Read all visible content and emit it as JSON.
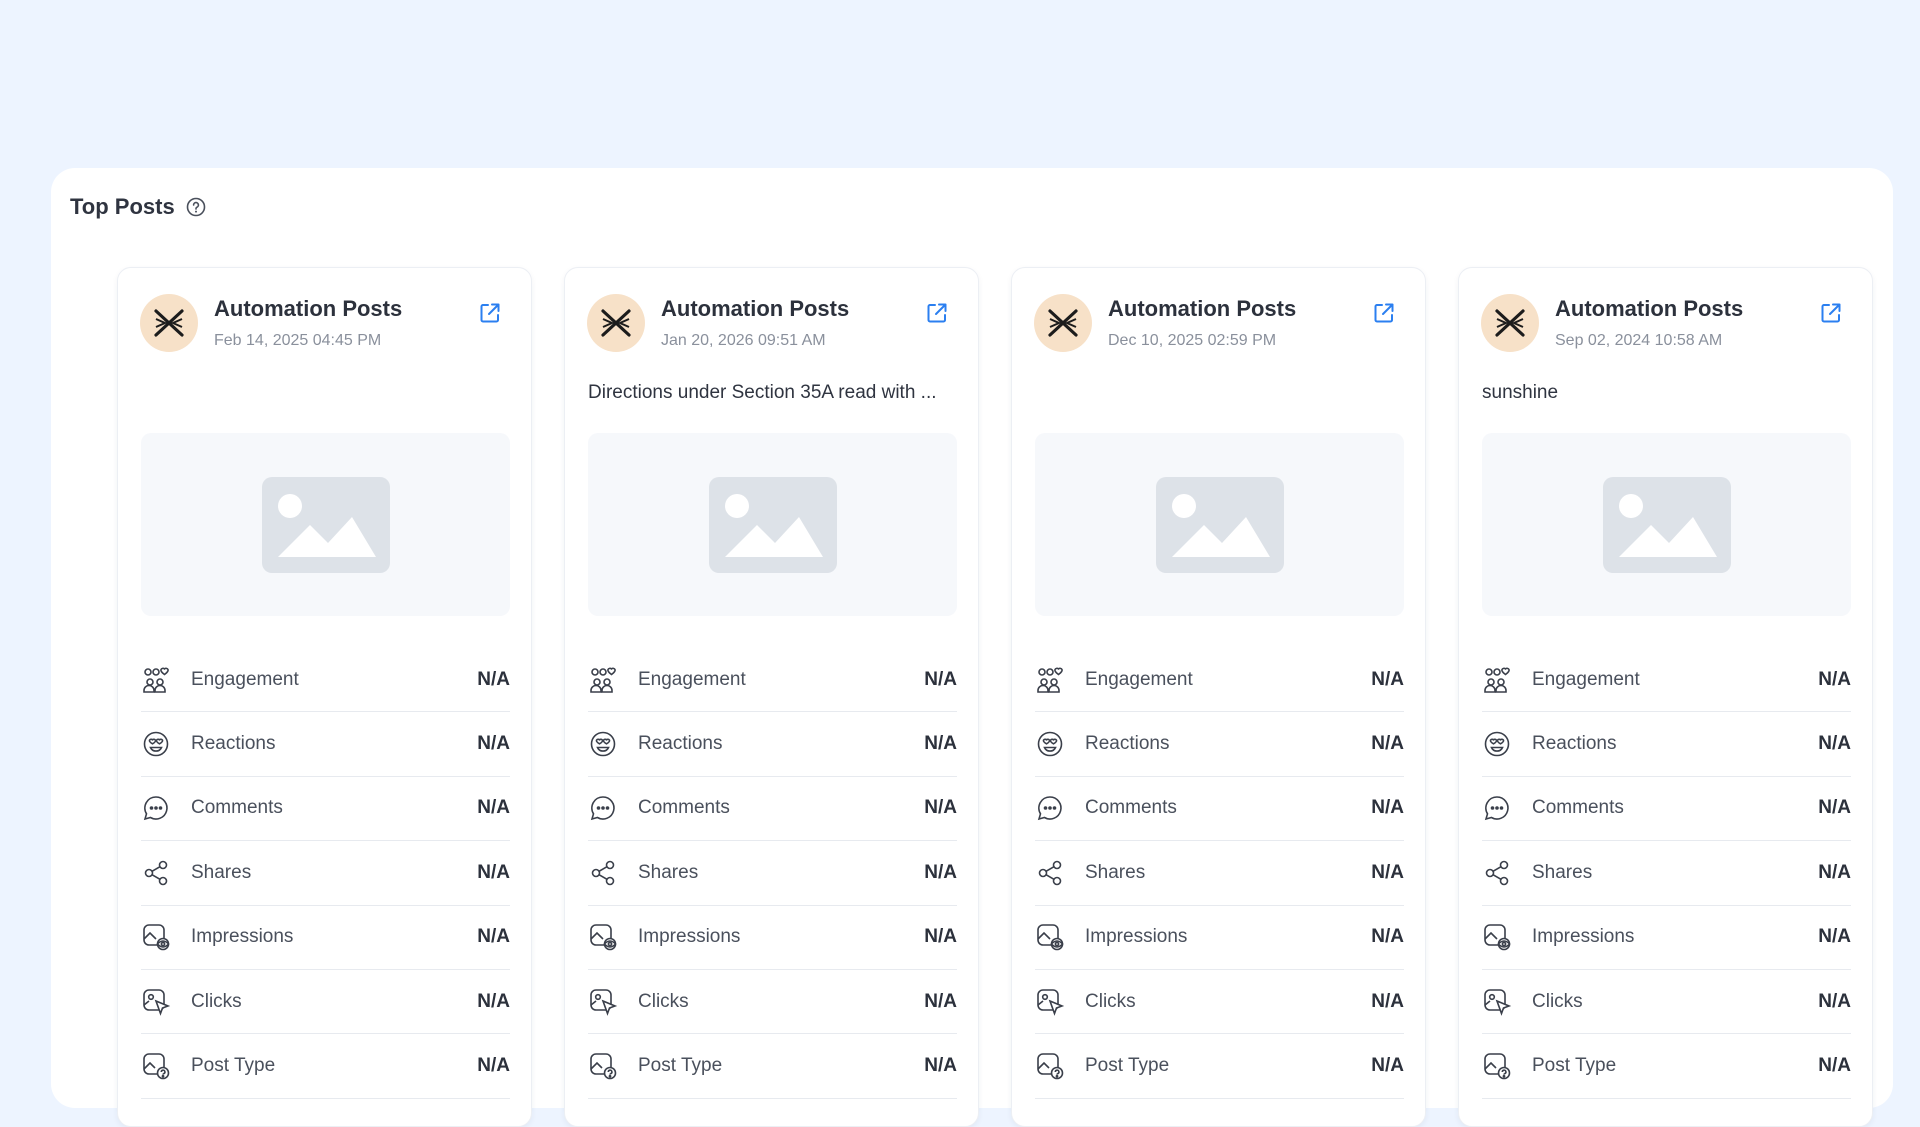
{
  "section": {
    "title": "Top Posts"
  },
  "colors": {
    "accent": "#2b7ff0",
    "avatar_bg": "#f7e1c8",
    "page_bg": "#edf4ff"
  },
  "metric_labels": [
    "Engagement",
    "Reactions",
    "Comments",
    "Shares",
    "Impressions",
    "Clicks",
    "Post Type"
  ],
  "posts": [
    {
      "account": "Automation Posts",
      "date": "Feb 14, 2025 04:45 PM",
      "text": "",
      "metrics": [
        "N/A",
        "N/A",
        "N/A",
        "N/A",
        "N/A",
        "N/A",
        "N/A"
      ]
    },
    {
      "account": "Automation Posts",
      "date": "Jan 20, 2026 09:51 AM",
      "text": "Directions under Section 35A read with ...",
      "metrics": [
        "N/A",
        "N/A",
        "N/A",
        "N/A",
        "N/A",
        "N/A",
        "N/A"
      ]
    },
    {
      "account": "Automation Posts",
      "date": "Dec 10, 2025 02:59 PM",
      "text": "",
      "metrics": [
        "N/A",
        "N/A",
        "N/A",
        "N/A",
        "N/A",
        "N/A",
        "N/A"
      ]
    },
    {
      "account": "Automation Posts",
      "date": "Sep 02, 2024 10:58 AM",
      "text": "sunshine",
      "metrics": [
        "N/A",
        "N/A",
        "N/A",
        "N/A",
        "N/A",
        "N/A",
        "N/A"
      ]
    }
  ]
}
